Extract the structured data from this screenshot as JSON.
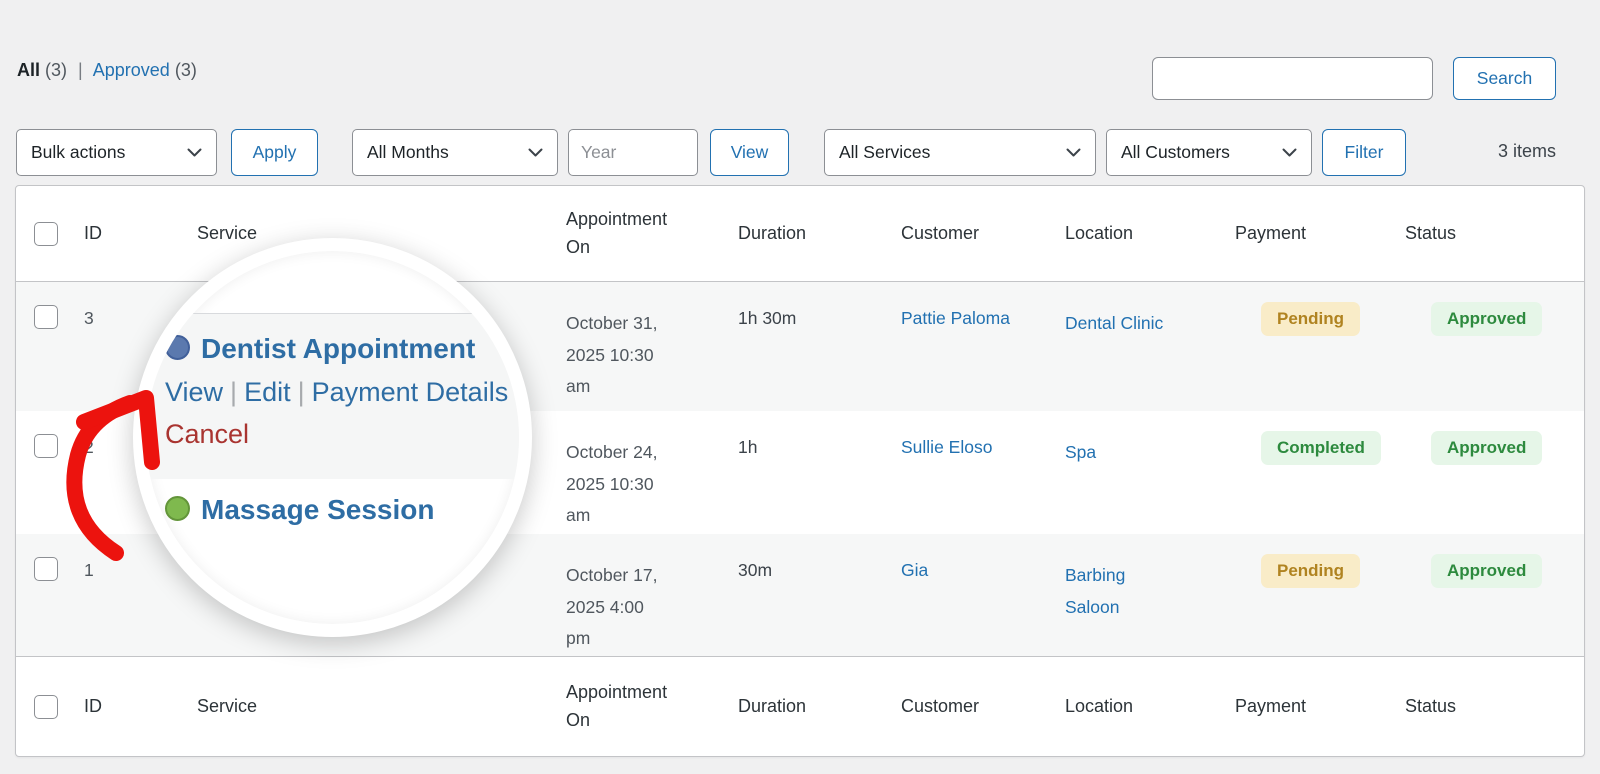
{
  "filters": {
    "all_label": "All",
    "all_count": "(3)",
    "separator": "|",
    "approved_label": "Approved",
    "approved_count": "(3)"
  },
  "search": {
    "value": "",
    "button_label": "Search"
  },
  "toolbar": {
    "bulk_actions_label": "Bulk actions",
    "apply_label": "Apply",
    "all_months_label": "All Months",
    "year_placeholder": "Year",
    "view_label": "View",
    "all_services_label": "All Services",
    "all_customers_label": "All Customers",
    "filter_label": "Filter",
    "items_count": "3 items"
  },
  "table": {
    "columns": {
      "id": "ID",
      "service": "Service",
      "appointment_on": "Appointment On",
      "duration": "Duration",
      "customer": "Customer",
      "location": "Location",
      "payment": "Payment",
      "status": "Status"
    },
    "rows": [
      {
        "id": "3",
        "service": "Dentist Appointment",
        "appointment_on": "October 31, 2025 10:30 am",
        "duration": "1h 30m",
        "customer": "Pattie Paloma",
        "location": "Dental Clinic",
        "payment": "Pending",
        "status": "Approved"
      },
      {
        "id": "2",
        "service": "Massage Session",
        "appointment_on": "October 24, 2025 10:30 am",
        "duration": "1h",
        "customer": "Sullie Eloso",
        "location": "Spa",
        "payment": "Completed",
        "status": "Approved"
      },
      {
        "id": "1",
        "service": "",
        "appointment_on": "October 17, 2025 4:00 pm",
        "duration": "30m",
        "customer": "Gia",
        "location": "Barbing Saloon",
        "payment": "Pending",
        "status": "Approved"
      }
    ]
  },
  "magnifier": {
    "service_1": "Dentist Appointment",
    "service_2": "Massage Session",
    "row_actions": {
      "view": "View",
      "edit": "Edit",
      "payment_details": "Payment Details",
      "cancel": "Cancel",
      "separator": "|"
    }
  },
  "icons": {
    "chevron_down": "v",
    "checkbox": "rounded-square",
    "service_dot_blue": "circle",
    "service_dot_green": "circle",
    "red_arrow": "hand-drawn-curved-arrow"
  },
  "colors": {
    "accent_blue": "#2271b1",
    "header_text": "#2c3338",
    "page_bg": "#f0f0f1",
    "row_stripe": "#f6f7f7",
    "table_border": "#c3c4c7",
    "pending_bg": "#f9ecc8",
    "pending_text": "#b08320",
    "approved_bg": "#e6f6e8",
    "approved_text": "#2d8a3e",
    "service_link": "#2e6da4",
    "cancel_red": "#a93430",
    "dot_blue": "#5b79ae",
    "dot_green": "#7fb94e",
    "arrow_red": "#ec130e"
  }
}
